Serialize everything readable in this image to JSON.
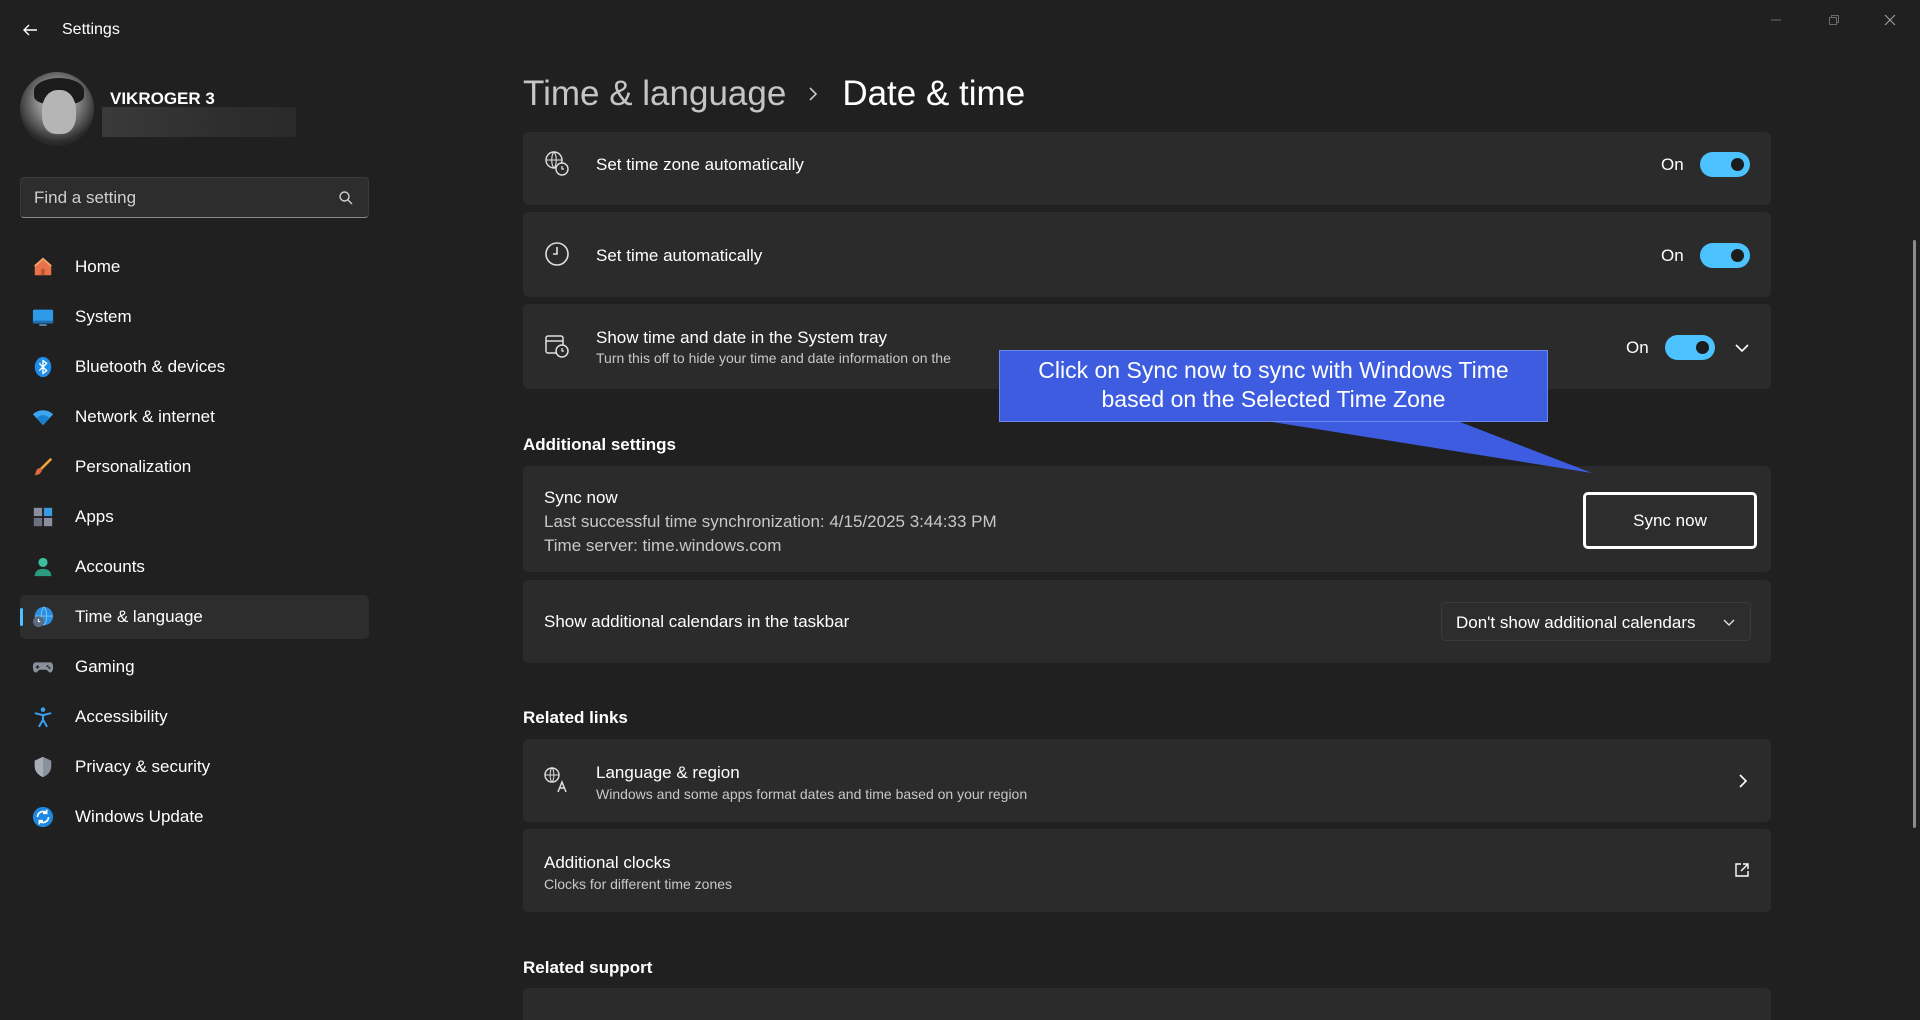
{
  "window": {
    "title": "Settings",
    "controls": {
      "minimize": "minimize-icon",
      "maximize": "restore-icon",
      "close": "close-icon"
    }
  },
  "user": {
    "name": "VIKROGER 3"
  },
  "search": {
    "placeholder": "Find a setting"
  },
  "nav": {
    "items": [
      {
        "label": "Home",
        "icon": "home-icon",
        "active": false
      },
      {
        "label": "System",
        "icon": "monitor-icon",
        "active": false
      },
      {
        "label": "Bluetooth & devices",
        "icon": "bluetooth-icon",
        "active": false
      },
      {
        "label": "Network & internet",
        "icon": "wifi-icon",
        "active": false
      },
      {
        "label": "Personalization",
        "icon": "brush-icon",
        "active": false
      },
      {
        "label": "Apps",
        "icon": "apps-icon",
        "active": false
      },
      {
        "label": "Accounts",
        "icon": "person-icon",
        "active": false
      },
      {
        "label": "Time & language",
        "icon": "globe-clock-icon",
        "active": true
      },
      {
        "label": "Gaming",
        "icon": "gamepad-icon",
        "active": false
      },
      {
        "label": "Accessibility",
        "icon": "accessibility-icon",
        "active": false
      },
      {
        "label": "Privacy & security",
        "icon": "shield-icon",
        "active": false
      },
      {
        "label": "Windows Update",
        "icon": "update-icon",
        "active": false
      }
    ]
  },
  "breadcrumb": {
    "parent": "Time & language",
    "current": "Date & time"
  },
  "settings": {
    "timezone_auto": {
      "title": "Set time zone automatically",
      "state": "On",
      "enabled": true
    },
    "time_auto": {
      "title": "Set time automatically",
      "state": "On",
      "enabled": true
    },
    "systray": {
      "title": "Show time and date in the System tray",
      "subtitle": "Turn this off to hide your time and date information on the",
      "state": "On",
      "enabled": true
    }
  },
  "additional": {
    "section_title": "Additional settings",
    "sync": {
      "title": "Sync now",
      "last_sync": "Last successful time synchronization: 4/15/2025 3:44:33 PM",
      "server": "Time server: time.windows.com",
      "button_label": "Sync now"
    },
    "calendars": {
      "title": "Show additional calendars in the taskbar",
      "selected": "Don't show additional calendars"
    }
  },
  "related_links": {
    "section_title": "Related links",
    "language_region": {
      "title": "Language & region",
      "subtitle": "Windows and some apps format dates and time based on your region"
    },
    "additional_clocks": {
      "title": "Additional clocks",
      "subtitle": "Clocks for different time zones"
    }
  },
  "related_support": {
    "section_title": "Related support"
  },
  "callout": {
    "line1": "Click on Sync now to sync with Windows Time",
    "line2": "based on the Selected Time Zone"
  },
  "colors": {
    "accent": "#4cc2ff",
    "background": "#202020",
    "card": "#2b2b2b",
    "callout": "#3d5ce0"
  }
}
